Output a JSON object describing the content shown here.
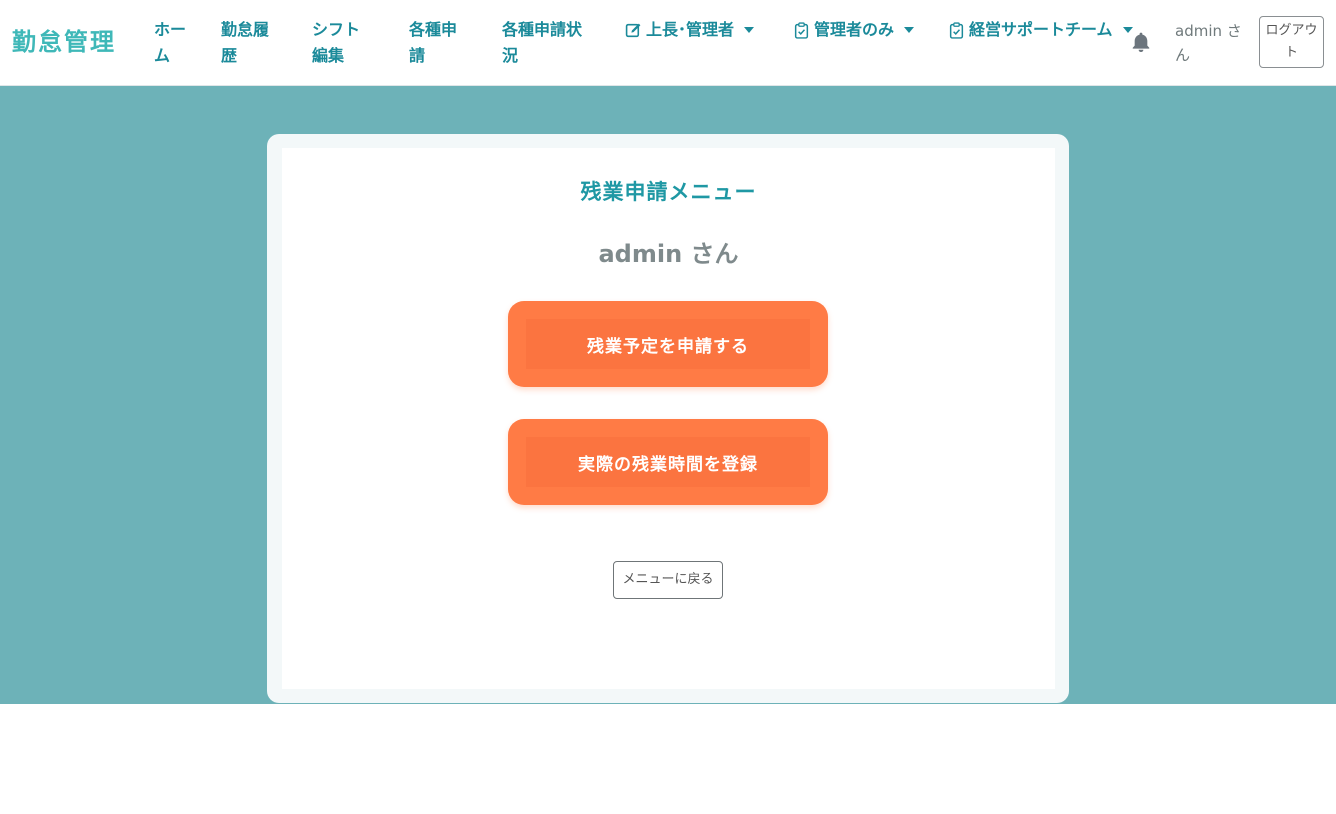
{
  "navbar": {
    "brand": "勤怠管理",
    "links": {
      "home": "ホーム",
      "attendance_history": "勤怠履歴",
      "shift_edit": "シフト編集",
      "requests": "各種申請",
      "request_status": "各種申請状況"
    },
    "dropdowns": {
      "supervisor": "上長･管理者",
      "admin_only": "管理者のみ",
      "management_support": "経営サポートチーム"
    },
    "user_label": "admin さん",
    "logout": "ログアウト"
  },
  "main": {
    "title": "残業申請メニュー",
    "user_name": "admin さん",
    "buttons": {
      "request_overtime": "残業予定を申請する",
      "register_actual": "実際の残業時間を登録"
    },
    "back": "メニューに戻る"
  },
  "colors": {
    "accent": "#1b8a9a",
    "brand": "#3fb8b8",
    "background": "#6db2b8",
    "action_button": "#ff7b45"
  },
  "icons": [
    "edit-icon",
    "clipboard-check-icon",
    "bell-icon"
  ]
}
